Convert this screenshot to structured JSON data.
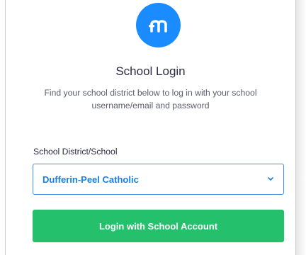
{
  "app": {
    "logo_icon": "mathletics-m-logo",
    "brand_color": "#1a8cff"
  },
  "login": {
    "title": "School Login",
    "description": "Find your school district below to log in with your school username/email and password",
    "field_label": "School District/School",
    "selected_school": "Dufferin-Peel Catholic",
    "submit_label": "Login with School Account",
    "submit_color": "#25c06b",
    "select_text_color": "#1a7fe0"
  }
}
